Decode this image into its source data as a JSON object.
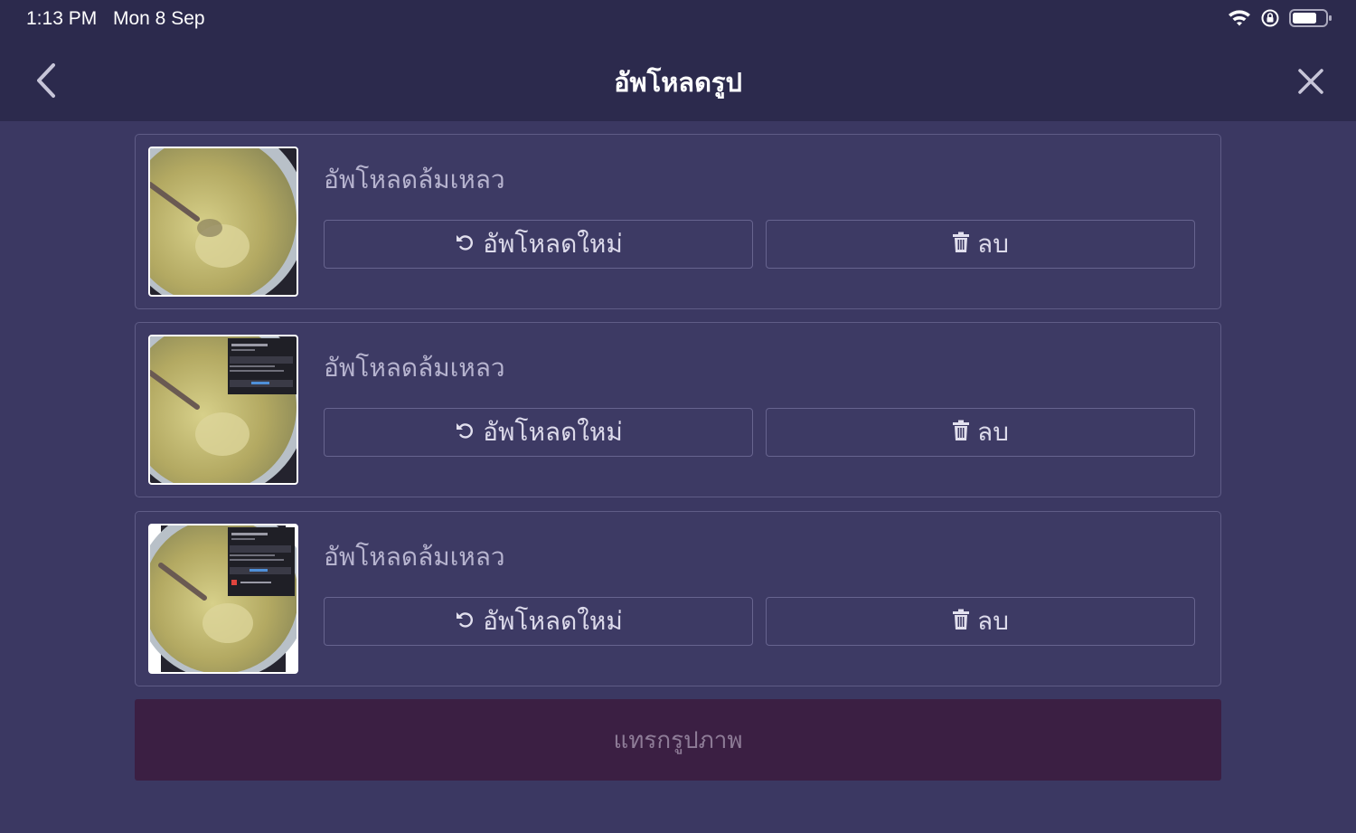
{
  "status_bar": {
    "time": "1:13 PM",
    "date": "Mon 8 Sep"
  },
  "nav": {
    "title": "อัพโหลดรูป",
    "back_icon": "chevron-left-icon",
    "close_icon": "close-icon"
  },
  "uploads": [
    {
      "status": "อัพโหลดล้มเหลว",
      "reupload_label": "อัพโหลดใหม่",
      "delete_label": "ลบ",
      "thumbnail": "photo-soup-bowl"
    },
    {
      "status": "อัพโหลดล้มเหลว",
      "reupload_label": "อัพโหลดใหม่",
      "delete_label": "ลบ",
      "thumbnail": "photo-soup-bowl-with-screenshot-overlay"
    },
    {
      "status": "อัพโหลดล้มเหลว",
      "reupload_label": "อัพโหลดใหม่",
      "delete_label": "ลบ",
      "thumbnail": "photo-soup-bowl-with-screenshot-overlay"
    }
  ],
  "insert_button": {
    "label": "แทรกรูปภาพ"
  },
  "colors": {
    "background": "#3b3862",
    "header": "#2c2a4d",
    "insert_button": "#3b1f43"
  }
}
